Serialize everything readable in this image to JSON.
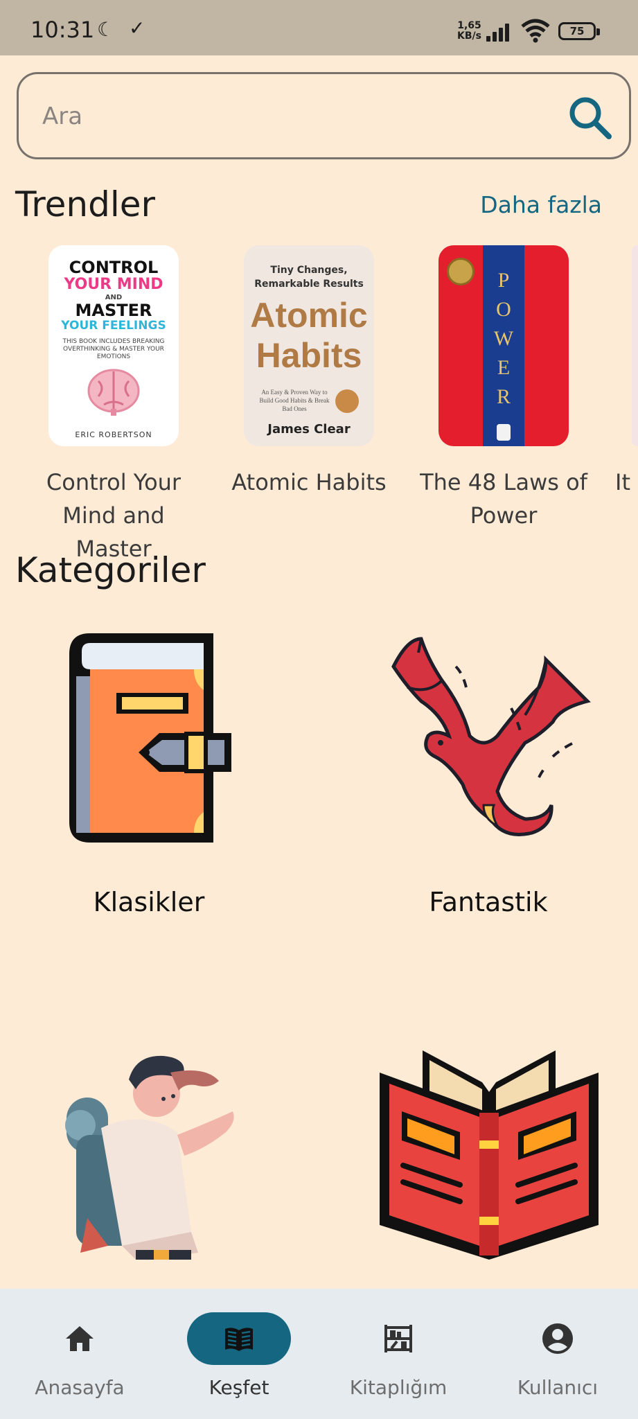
{
  "status_bar": {
    "time": "10:31",
    "network_speed_value": "1,65",
    "network_speed_unit": "KB/s",
    "battery": "75"
  },
  "search": {
    "placeholder": "Ara"
  },
  "trends": {
    "title": "Trendler",
    "more_label": "Daha fazla",
    "books": [
      {
        "title": "Control Your Mind and Master",
        "cover": {
          "line1": "CONTROL",
          "line2": "YOUR MIND",
          "line3": "AND",
          "line4": "MASTER",
          "line5": "YOUR FEELINGS",
          "small": "THIS BOOK INCLUDES BREAKING OVERTHINKING & MASTER YOUR EMOTIONS",
          "author": "ERIC ROBERTSON"
        }
      },
      {
        "title": "Atomic Habits",
        "cover": {
          "subtitle": "Tiny Changes, Remarkable Results",
          "main": "Atomic Habits",
          "small": "An Easy & Proven Way to Build Good Habits & Break Bad Ones",
          "author": "James Clear"
        }
      },
      {
        "title": "The 48 Laws of Power",
        "cover": {
          "word": "POWER"
        }
      },
      {
        "title": "It I"
      }
    ]
  },
  "categories": {
    "title": "Kategoriler",
    "items": [
      {
        "label": "Klasikler",
        "icon": "closed-book-icon"
      },
      {
        "label": "Fantastik",
        "icon": "dragon-icon"
      },
      {
        "label": "",
        "icon": "explorer-icon"
      },
      {
        "label": "",
        "icon": "open-book-icon"
      }
    ]
  },
  "bottom_nav": {
    "items": [
      {
        "label": "Anasayfa",
        "icon": "home-icon",
        "active": false
      },
      {
        "label": "Keşfet",
        "icon": "book-open-icon",
        "active": true
      },
      {
        "label": "Kitaplığım",
        "icon": "bookshelf-icon",
        "active": false
      },
      {
        "label": "Kullanıcı",
        "icon": "account-icon",
        "active": false
      }
    ]
  },
  "colors": {
    "background": "#fdebd6",
    "status_bar": "#c1b5a4",
    "accent": "#156680",
    "nav_background": "#e5ebef"
  }
}
